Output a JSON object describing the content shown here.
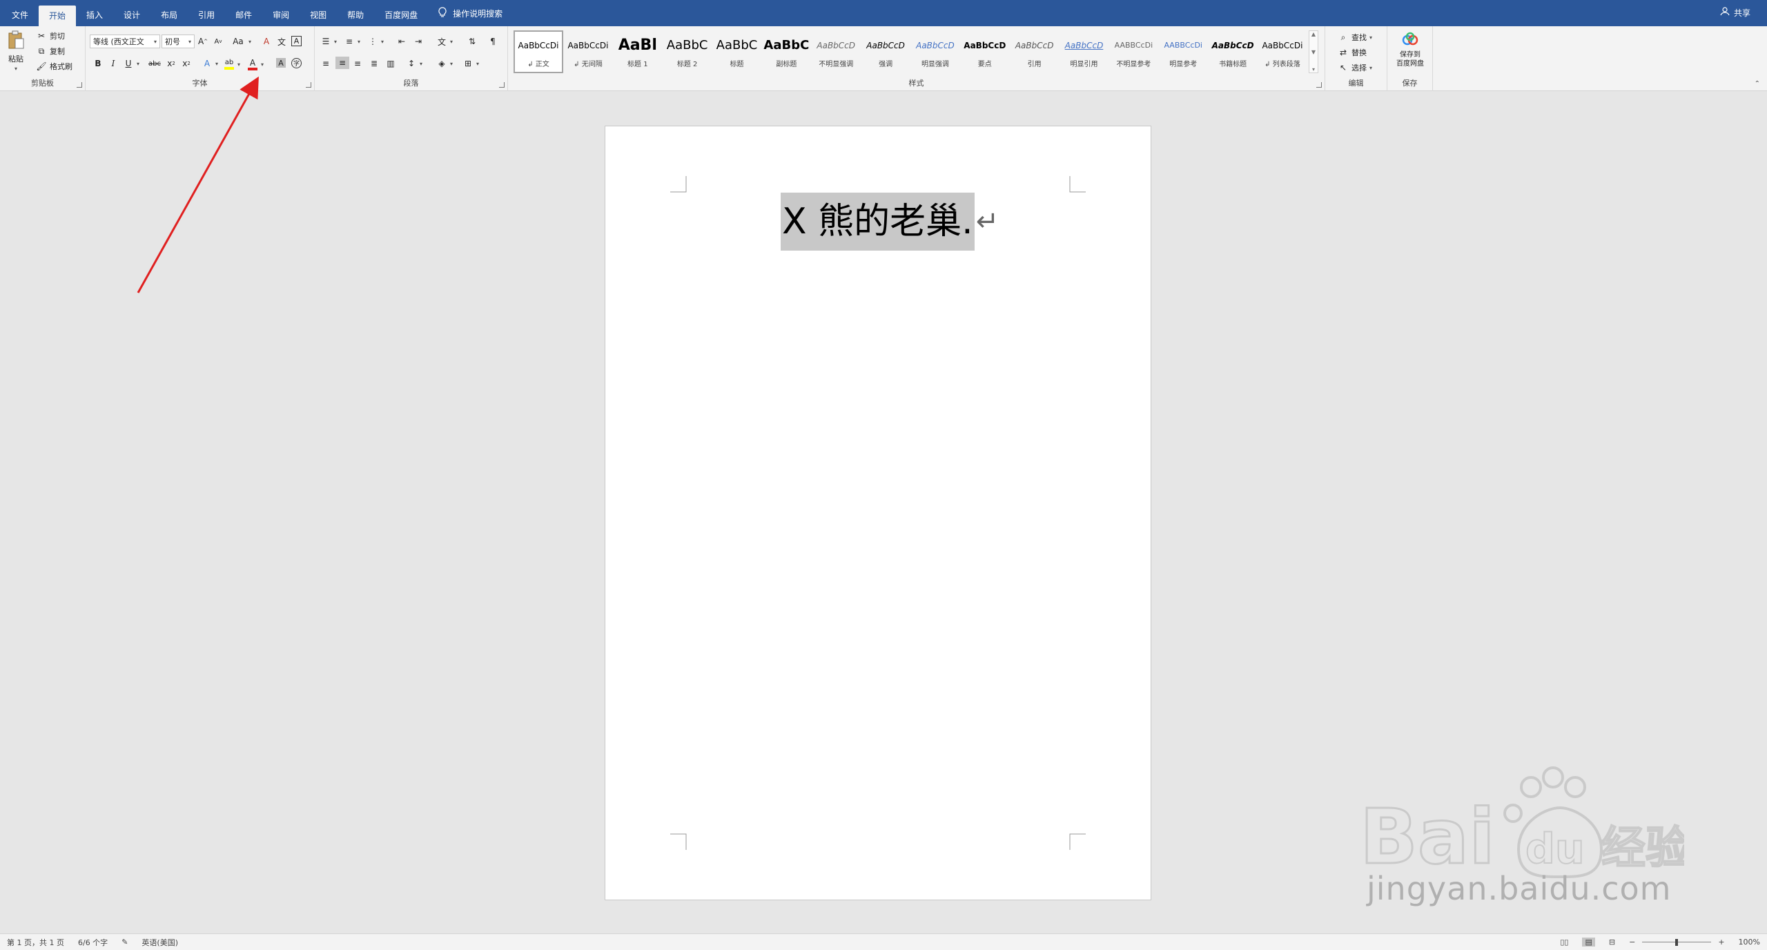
{
  "tabs": [
    "文件",
    "开始",
    "插入",
    "设计",
    "布局",
    "引用",
    "邮件",
    "审阅",
    "视图",
    "帮助",
    "百度网盘"
  ],
  "active_tab": "开始",
  "tell_me": "操作说明搜索",
  "share": "共享",
  "clipboard": {
    "paste": "粘贴",
    "cut": "剪切",
    "copy": "复制",
    "format_painter": "格式刷",
    "label": "剪贴板"
  },
  "font": {
    "font_name": "等线 (西文正文",
    "font_size": "初号",
    "label": "字体"
  },
  "paragraph": {
    "label": "段落"
  },
  "styles": {
    "label": "样式",
    "items": [
      {
        "preview": "AaBbCcDi",
        "name": "↲ 正文"
      },
      {
        "preview": "AaBbCcDi",
        "name": "↲ 无间隔"
      },
      {
        "preview": "AaBl",
        "name": "标题 1"
      },
      {
        "preview": "AaBbC",
        "name": "标题 2"
      },
      {
        "preview": "AaBbC",
        "name": "标题"
      },
      {
        "preview": "AaBbC",
        "name": "副标题"
      },
      {
        "preview": "AaBbCcD",
        "name": "不明显强调"
      },
      {
        "preview": "AaBbCcD",
        "name": "强调"
      },
      {
        "preview": "AaBbCcD",
        "name": "明显强调"
      },
      {
        "preview": "AaBbCcD",
        "name": "要点"
      },
      {
        "preview": "AaBbCcD",
        "name": "引用"
      },
      {
        "preview": "AaBbCcD",
        "name": "明显引用"
      },
      {
        "preview": "AABBCcDi",
        "name": "不明显参考"
      },
      {
        "preview": "AABBCcDi",
        "name": "明显参考"
      },
      {
        "preview": "AaBbCcD",
        "name": "书籍标题"
      },
      {
        "preview": "AaBbCcDi",
        "name": "↲ 列表段落"
      }
    ]
  },
  "editing": {
    "find": "查找",
    "replace": "替换",
    "select": "选择",
    "label": "编辑"
  },
  "save": {
    "button": "保存到\n百度网盘",
    "label": "保存"
  },
  "document": {
    "text": "X 熊的老巢."
  },
  "status": {
    "page": "第 1 页，共 1 页",
    "words": "6/6 个字",
    "language": "英语(美国)",
    "zoom": "100%"
  },
  "watermark": {
    "text": "jingyan.baidu.com"
  },
  "colors": {
    "ribbon_blue": "#2b579a",
    "font_color_underline": "#e02020",
    "highlight_yellow": "#ffff00",
    "arrow_red": "#e02020"
  }
}
